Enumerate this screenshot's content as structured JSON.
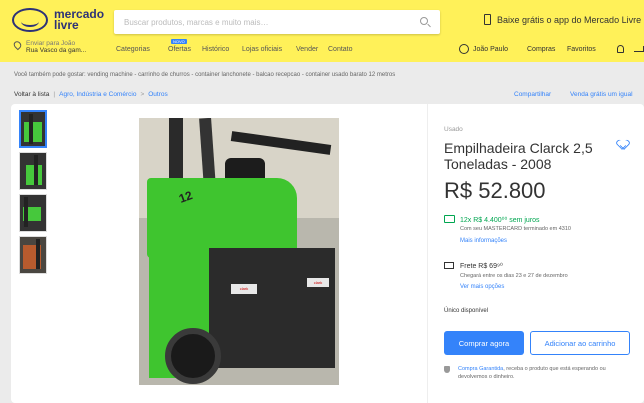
{
  "header": {
    "logo_line1": "mercado",
    "logo_line2": "livre",
    "search_placeholder": "Buscar produtos, marcas e muito mais…",
    "app_promo": "Baixe grátis o app do Mercado Livre",
    "location_line1": "Enviar para João",
    "location_line2": "Rua Vasco da gam...",
    "nav": {
      "categories": "Categorias",
      "offers": "Ofertas",
      "offers_badge": "NOVO",
      "history": "Histórico",
      "official_stores": "Lojas oficiais",
      "sell": "Vender",
      "contact": "Contato"
    },
    "user": {
      "name": "João Paulo",
      "purchases": "Compras",
      "favorites": "Favoritos"
    }
  },
  "reco_text": "Você também pode gostar: vending machine - carrinho de churros - container lanchonete - balcao recepcao - container usado barato 12 metros",
  "breadcrumb": {
    "back": "Voltar à lista",
    "level1": "Agro, Indústria e Comércio",
    "level2": "Outros",
    "share": "Compartilhar",
    "sell_one": "Venda grátis um igual"
  },
  "product": {
    "condition": "Usado",
    "title": "Empilhadeira Clarck 2,5 Toneladas - 2008",
    "price": "R$ 52.800",
    "installments": "12x R$ 4.400⁰⁰ sem juros",
    "card_note": "Com seu MASTERCARD terminado em 4310",
    "more_info": "Mais informações",
    "freight": "Frete R$ 69⁹⁰",
    "delivery": "Chegará entre os dias 23 e 27 de dezembro",
    "more_options": "Ver mais opções",
    "stock": "Único disponível",
    "buy_now": "Comprar agora",
    "add_to_cart": "Adicionar ao carrinho",
    "guarantee_link": "Compra Garantida",
    "guarantee_text": ", receba o produto que está esperando ou devolvemos o dinheiro."
  },
  "colors": {
    "header_bg": "#fff159",
    "accent_blue": "#3483fa",
    "success_green": "#00a650"
  },
  "icons": [
    "logo-handshake-icon",
    "search-icon",
    "phone-icon",
    "location-pin-icon",
    "avatar-icon",
    "bell-icon",
    "cart-icon",
    "heart-icon",
    "credit-card-icon",
    "truck-icon",
    "shield-icon"
  ]
}
